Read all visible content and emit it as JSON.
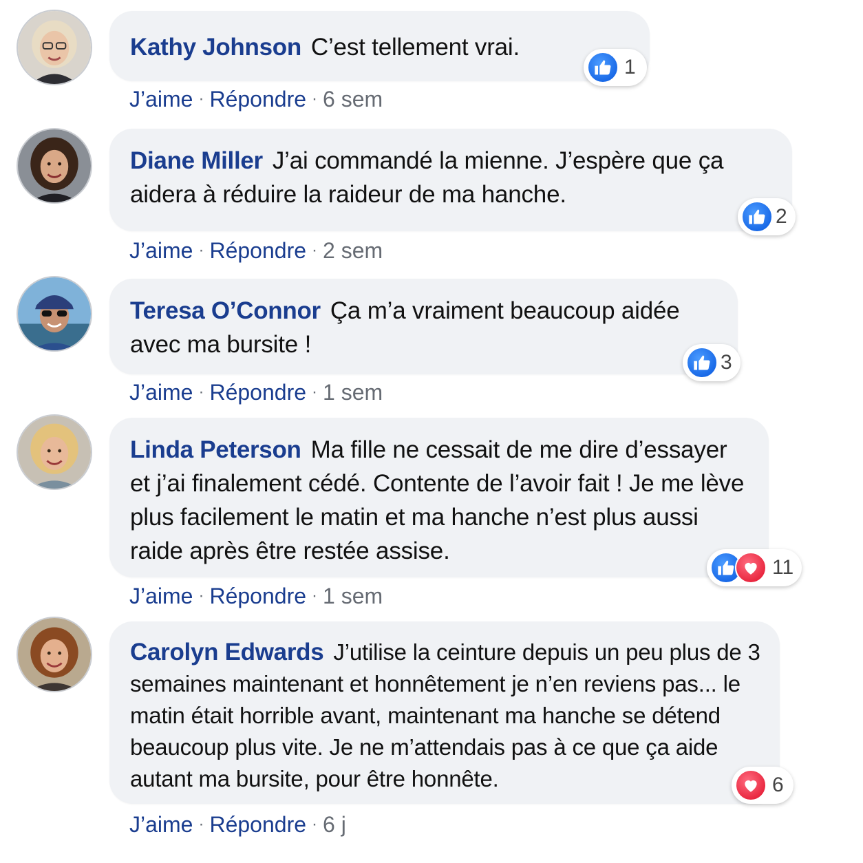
{
  "comments": [
    {
      "author": "Kathy Johnson",
      "text": "C’est tellement vrai.",
      "reaction_icons": [
        "like-icon"
      ],
      "reaction_count": "1",
      "like_label": "J’aime",
      "reply_label": "Répondre",
      "separator": "·",
      "time": "6 sem"
    },
    {
      "author": "Diane Miller",
      "text": "J’ai commandé la mienne. J’espère que ça aidera à réduire la raideur de ma hanche.",
      "reaction_icons": [
        "like-icon"
      ],
      "reaction_count": "2",
      "like_label": "J’aime",
      "reply_label": "Répondre",
      "separator": "·",
      "time": "2 sem"
    },
    {
      "author": "Teresa O’Connor",
      "text": "Ça m’a vraiment beaucoup aidée avec ma bursite !",
      "reaction_icons": [
        "like-icon"
      ],
      "reaction_count": "3",
      "like_label": "J’aime",
      "reply_label": "Répondre",
      "separator": "·",
      "time": "1 sem"
    },
    {
      "author": "Linda Peterson",
      "text": "Ma fille ne cessait de me dire d’essayer et j’ai finalement cédé. Contente de l’avoir fait ! Je me lève plus facilement le matin et ma hanche n’est plus aussi raide après être restée assise.",
      "reaction_icons": [
        "like-icon",
        "love-icon"
      ],
      "reaction_count": "11",
      "like_label": "J’aime",
      "reply_label": "Répondre",
      "separator": "·",
      "time": "1 sem"
    },
    {
      "author": "Carolyn Edwards",
      "text": "J’utilise la ceinture depuis un peu plus de 3 semaines maintenant et honnêtement je n’en reviens pas... le matin était horrible avant, maintenant ma hanche se détend beaucoup plus vite. Je ne m’attendais pas à ce que ça aide autant ma bursite, pour être honnête.",
      "reaction_icons": [
        "love-icon"
      ],
      "reaction_count": "6",
      "like_label": "J’aime",
      "reply_label": "Répondre",
      "separator": "·",
      "time": "6 j"
    }
  ],
  "colors": {
    "author": "#1a3d8f",
    "bubble": "#f0f2f5",
    "like": "#1767e6",
    "love": "#e8253d",
    "meta": "#666b73"
  }
}
